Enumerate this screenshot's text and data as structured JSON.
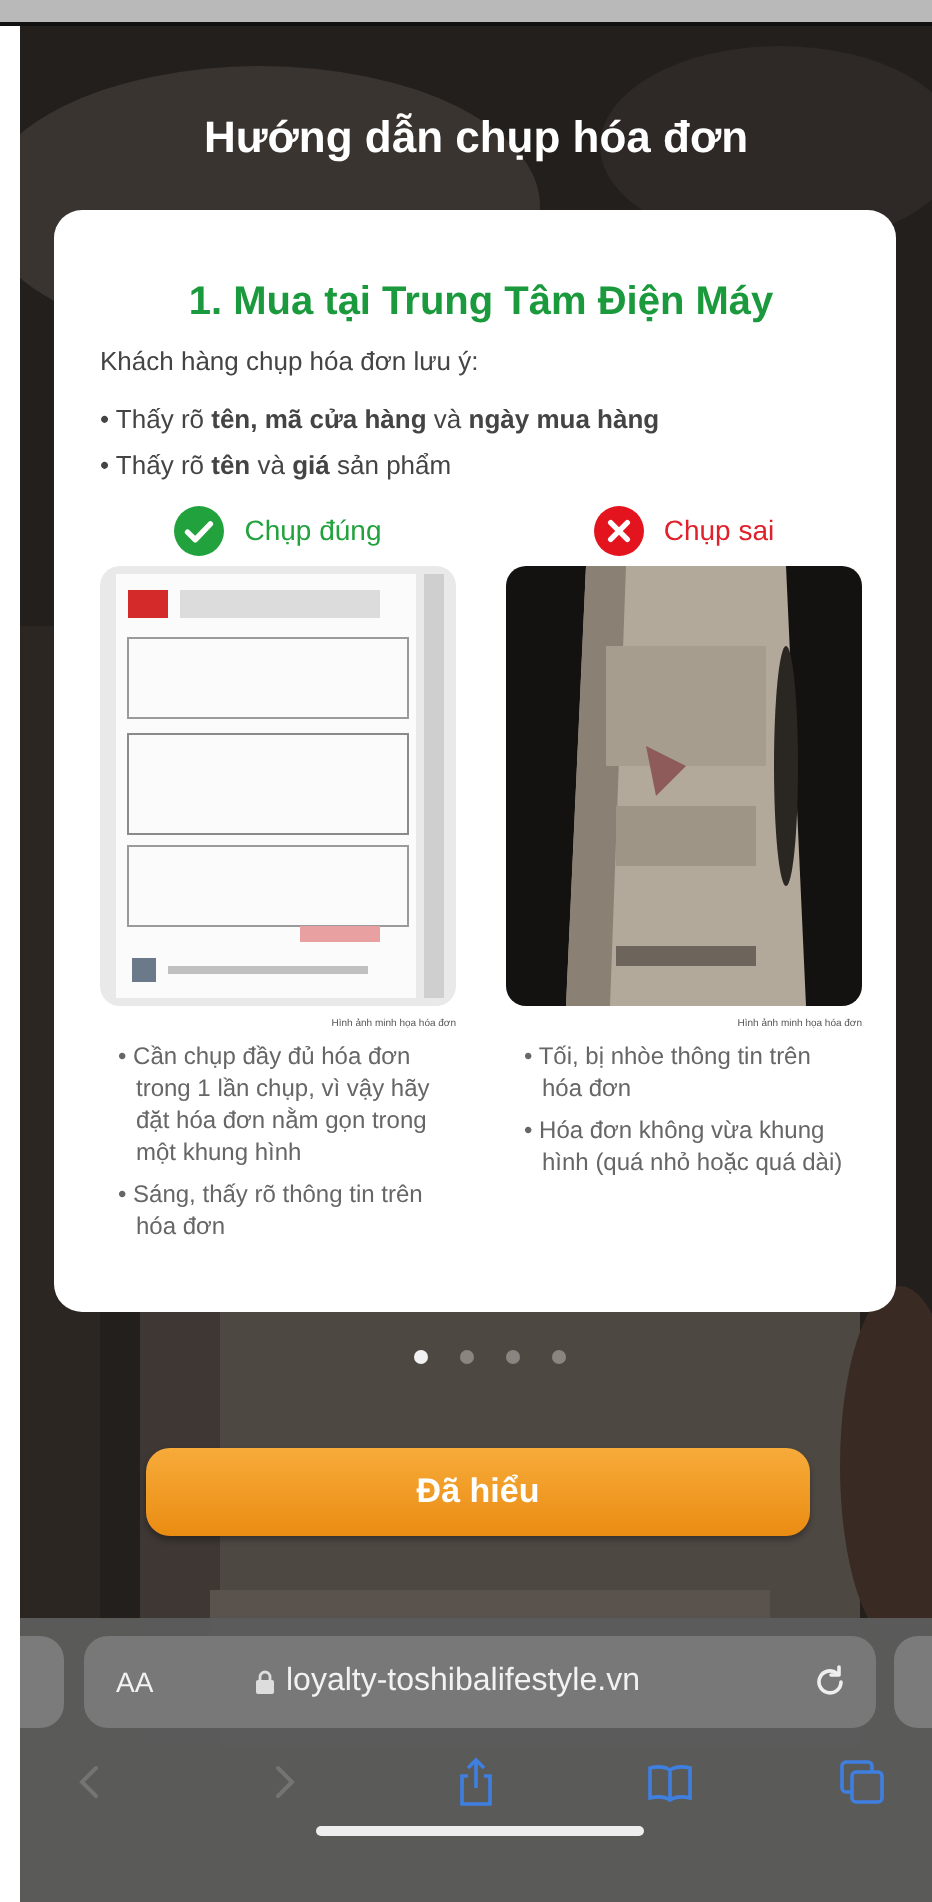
{
  "title": "Hướng dẫn chụp hóa đơn",
  "card": {
    "heading": "1. Mua tại Trung Tâm Điện Máy",
    "intro": "Khách hàng chụp hóa đơn lưu ý:",
    "notes": [
      "• Thấy rõ **tên, mã cửa hàng** và **ngày mua hàng**",
      "• Thấy rõ **tên** và **giá** sản phẩm"
    ],
    "examples": [
      {
        "kind": "good",
        "label": "Chụp đúng",
        "caption": "Hình ảnh minh họa hóa đơn",
        "bullets": [
          "• Cần chụp đầy đủ hóa đơn trong 1 lần chụp, vì vậy hãy đặt hóa đơn nằm gọn trong một khung hình",
          "• Sáng, thấy rõ thông tin trên hóa đơn"
        ]
      },
      {
        "kind": "bad",
        "label": "Chụp sai",
        "caption": "Hình ảnh minh họa hóa đơn",
        "bullets": [
          "• Tối, bị nhòe thông tin trên hóa đơn",
          "• Hóa đơn không vừa khung hình (quá nhỏ hoặc quá dài)"
        ]
      }
    ]
  },
  "pager": [
    {
      "selected": true
    },
    {
      "selected": false
    },
    {
      "selected": false
    },
    {
      "selected": false
    }
  ],
  "button": "Đã hiểu",
  "browser": {
    "text_size": "AA",
    "url": "loyalty-toshibalifestyle.vn",
    "back": {
      "disabled": true
    },
    "forward": {
      "disabled": true
    }
  }
}
